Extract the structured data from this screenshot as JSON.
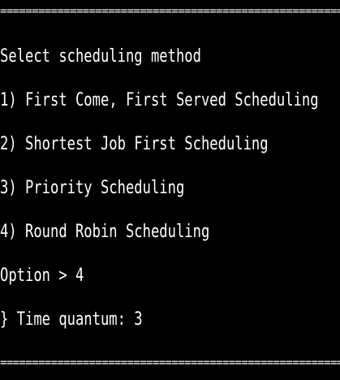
{
  "terminal": {
    "rule_top": "==============================================================================",
    "rule_bottom": "==============================================================================",
    "lines": [
      "Select scheduling method",
      "1) First Come, First Served Scheduling",
      "2) Shortest Job First Scheduling",
      "3) Priority Scheduling",
      "4) Round Robin Scheduling",
      "Option > 4",
      "} Time quantum: 3"
    ]
  },
  "colors": {
    "background": "#000000",
    "text": "#ffffff"
  }
}
